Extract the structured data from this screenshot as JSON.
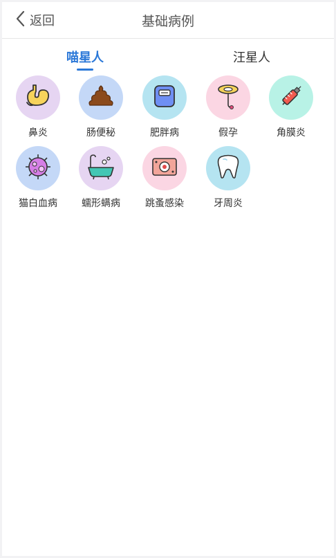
{
  "header": {
    "back_label": "返回",
    "title": "基础病例"
  },
  "tabs": [
    {
      "label": "喵星人"
    },
    {
      "label": "汪星人"
    }
  ],
  "active_tab": "喵星人",
  "items": [
    {
      "label": "鼻炎",
      "icon": "stomach-icon",
      "bg": "#e6d5f2"
    },
    {
      "label": "肠便秘",
      "icon": "poop-icon",
      "bg": "#c4d8f7"
    },
    {
      "label": "肥胖病",
      "icon": "scale-icon",
      "bg": "#b5e4f1"
    },
    {
      "label": "假孕",
      "icon": "iud-icon",
      "bg": "#fbd6e3"
    },
    {
      "label": "角膜炎",
      "icon": "syringe-icon",
      "bg": "#b8f2e6"
    },
    {
      "label": "猫白血病",
      "icon": "virus-icon",
      "bg": "#c4d8f7"
    },
    {
      "label": "蠕形螨病",
      "icon": "bathtub-icon",
      "bg": "#e6d5f2"
    },
    {
      "label": "跳蚤感染",
      "icon": "flea-card-icon",
      "bg": "#fbd6e3"
    },
    {
      "label": "牙周炎",
      "icon": "tooth-icon",
      "bg": "#b5e4f1"
    }
  ]
}
